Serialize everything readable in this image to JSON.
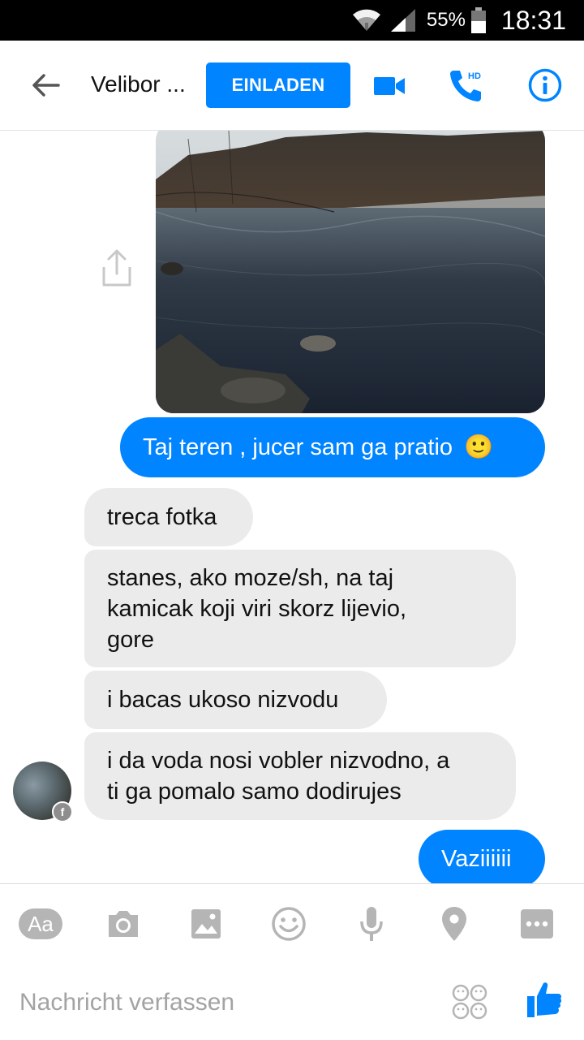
{
  "status_bar": {
    "battery_percent": "55%",
    "time": "18:31",
    "icons": [
      "wifi-icon",
      "signal-icon",
      "battery-icon"
    ]
  },
  "header": {
    "contact_name": "Velibor ...",
    "invite_label": "EINLADEN",
    "icons": [
      "back-arrow-icon",
      "video-call-icon",
      "hd-phone-icon",
      "info-icon"
    ],
    "accent_color": "#0084ff"
  },
  "messages": [
    {
      "type": "image",
      "direction": "outgoing",
      "description_icon": "share-icon"
    },
    {
      "type": "text",
      "direction": "outgoing",
      "text": "Taj teren ,  jucer sam ga pratio",
      "emoji": "🙂"
    },
    {
      "type": "text",
      "direction": "incoming",
      "text": "treca fotka"
    },
    {
      "type": "text",
      "direction": "incoming",
      "lines": [
        "stanes, ako moze/sh, na taj",
        "kamicak koji viri skorz lijevio,",
        "gore"
      ]
    },
    {
      "type": "text",
      "direction": "incoming",
      "text": "i bacas ukoso nizvodu"
    },
    {
      "type": "text",
      "direction": "incoming",
      "lines": [
        "i da voda nosi vobler nizvodno, a",
        "ti ga pomalo samo dodirujes"
      ]
    },
    {
      "type": "text",
      "direction": "outgoing",
      "text": "Vaziiiiii"
    }
  ],
  "composer": {
    "placeholder": "Nachricht verfassen",
    "aa_label": "Aa",
    "tools": [
      "text-format-icon",
      "camera-icon",
      "gallery-icon",
      "emoji-icon",
      "microphone-icon",
      "location-icon",
      "more-icon"
    ],
    "stickers_icon": "stickers-icon",
    "like_icon": "thumbs-up-icon"
  }
}
